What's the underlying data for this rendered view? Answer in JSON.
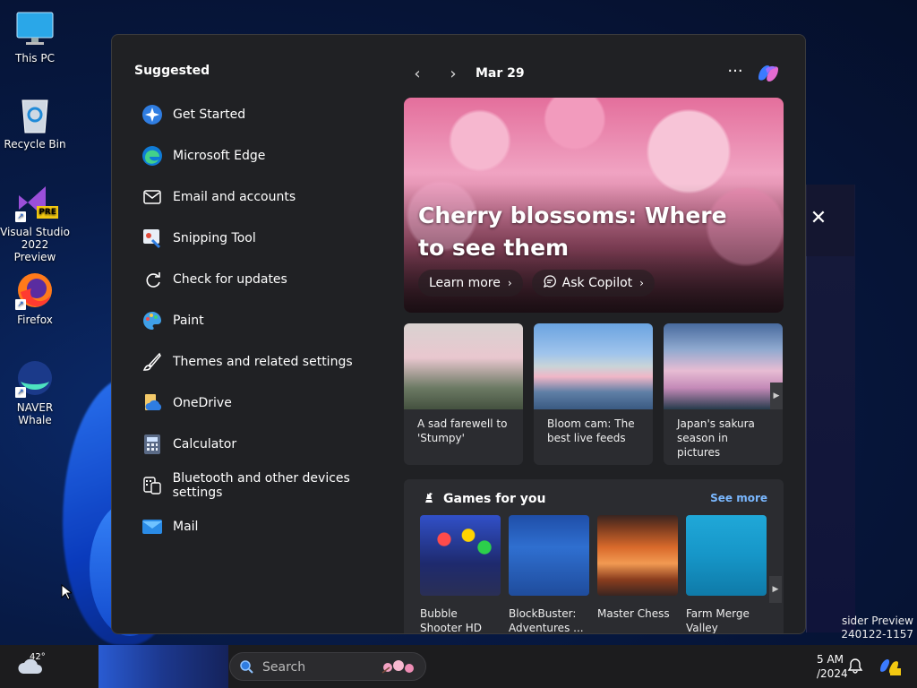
{
  "desktop": {
    "icons": [
      {
        "label": "This PC"
      },
      {
        "label": "Recycle Bin"
      },
      {
        "label": "Visual Studio 2022 Preview",
        "badge": "PRE"
      },
      {
        "label": "Firefox"
      },
      {
        "label": "NAVER Whale"
      }
    ],
    "watermark_line1": "sider Preview",
    "watermark_line2": "240122-1157"
  },
  "panel": {
    "suggested_title": "Suggested",
    "suggested": [
      {
        "label": "Get Started",
        "icon": "get-started-icon"
      },
      {
        "label": "Microsoft Edge",
        "icon": "edge-icon"
      },
      {
        "label": "Email and accounts",
        "icon": "mail-outline-icon"
      },
      {
        "label": "Snipping Tool",
        "icon": "snipping-tool-icon"
      },
      {
        "label": "Check for updates",
        "icon": "refresh-icon"
      },
      {
        "label": "Paint",
        "icon": "paint-icon"
      },
      {
        "label": "Themes and related settings",
        "icon": "brush-icon"
      },
      {
        "label": "OneDrive",
        "icon": "onedrive-icon"
      },
      {
        "label": "Calculator",
        "icon": "calculator-icon"
      },
      {
        "label": "Bluetooth and other devices settings",
        "icon": "devices-icon"
      },
      {
        "label": "Mail",
        "icon": "mail-app-icon"
      }
    ],
    "feed": {
      "date": "Mar 29",
      "more": "···",
      "hero_title": "Cherry blossoms: Where to see them",
      "learn_more": "Learn more",
      "ask_copilot": "Ask Copilot",
      "cards": [
        {
          "title": "A sad farewell to 'Stumpy'"
        },
        {
          "title": "Bloom cam: The best live feeds"
        },
        {
          "title": "Japan's sakura season in pictures"
        }
      ],
      "games_title": "Games for you",
      "see_more": "See more",
      "games": [
        {
          "name": "Bubble Shooter HD"
        },
        {
          "name": "BlockBuster: Adventures ..."
        },
        {
          "name": "Master Chess"
        },
        {
          "name": "Farm Merge Valley"
        }
      ]
    }
  },
  "taskbar": {
    "temperature": "42°",
    "search_placeholder": "Search",
    "time": "5 AM",
    "date": "/2024"
  }
}
